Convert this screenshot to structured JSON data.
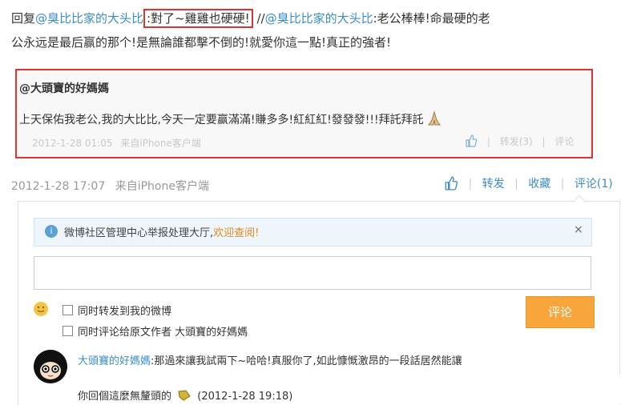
{
  "post": {
    "reply_prefix": "回复",
    "mention1": "@臭比比家的大头比",
    "boxed_text": ":對了~雞雞也硬硬!",
    "sep": " //",
    "mention2": "@臭比比家的大头比",
    "line1_tail": ":老公棒棒!命最硬的老",
    "line2": "公永远是最后赢的那个!是無論誰都擊不倒的!就愛你這一點!真正的強者!"
  },
  "quote": {
    "author": "@大頭寶的好媽媽",
    "body": "上天保佑我老公,我的大比比,今天一定要赢滿滿!賺多多!紅紅紅!發發發!!!拜託拜託",
    "time": "2012-1-28 01:05",
    "source": "来自iPhone客户端",
    "repost": "转发(3)",
    "comment": "评论"
  },
  "main": {
    "time": "2012-1-28 17:07",
    "source": "来自iPhone客户端",
    "repost": "转发",
    "favorite": "收藏",
    "comment": "评论(1)"
  },
  "notice": {
    "text": "微博社区管理中心举报处理大厅,",
    "link": "欢迎查阅!",
    "close": "×"
  },
  "composer": {
    "input_value": "",
    "opt1": "同时转发到我的微博",
    "opt2": "同时评论给原文作者 大頭寶的好媽媽",
    "submit": "评论"
  },
  "reply": {
    "author": "大頭寶的好媽媽",
    "text1": ":那過來讓我試兩下~哈哈!真服你了,如此慷慨激昂的一段話居然能讓",
    "text2": "你回個這麼無釐頭的",
    "time": "(2012-1-28 19:18)"
  }
}
